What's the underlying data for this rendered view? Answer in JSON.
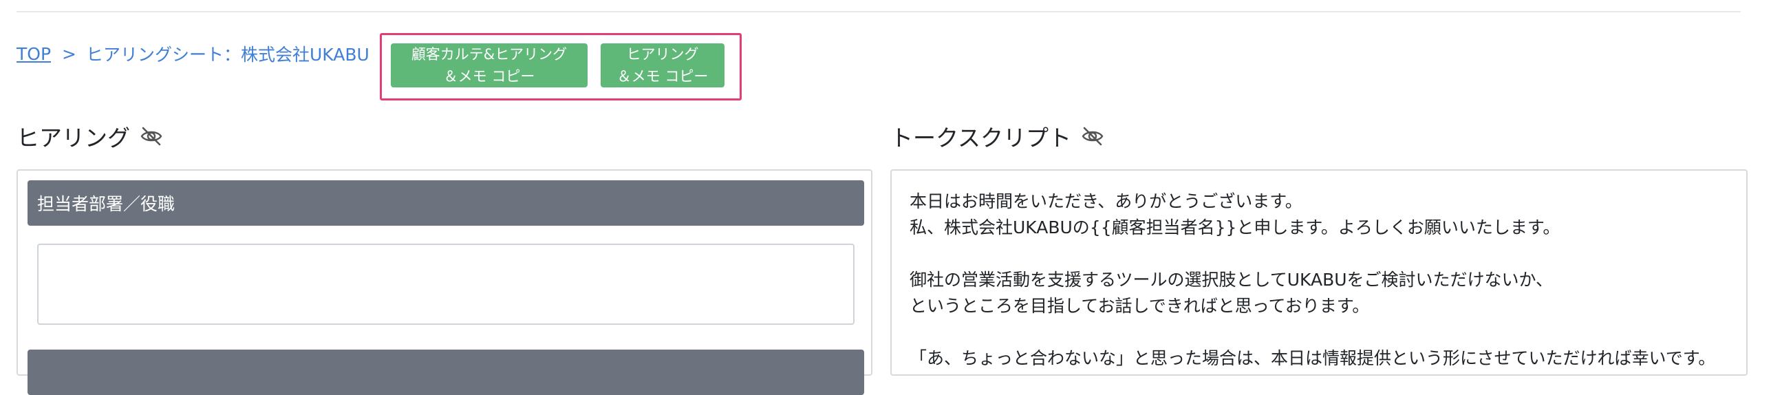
{
  "breadcrumb": {
    "top_link": "TOP",
    "separator": ">",
    "current": "ヒアリングシート：株式会社UKABU"
  },
  "copy_buttons": {
    "customer_karte_copy": "顧客カルテ&ヒアリング\n＆メモ コピー",
    "hearing_copy": "ヒアリング\n＆メモ コピー"
  },
  "hearing": {
    "title": "ヒアリング",
    "fields": [
      {
        "label": "担当者部署／役職",
        "value": ""
      },
      {
        "label": ""
      }
    ]
  },
  "talk_script": {
    "title": "トークスクリプト",
    "lines": [
      "本日はお時間をいただき、ありがとうございます。",
      "私、株式会社UKABUの{{顧客担当者名}}と申します。よろしくお願いいたします。",
      "",
      "御社の営業活動を支援するツールの選択肢としてUKABUをご検討いただけないか、",
      "というところを目指してお話しできればと思っております。",
      "",
      "「あ、ちょっと合わないな」と思った場合は、本日は情報提供という形にさせていただければ幸いです。"
    ]
  },
  "icons": {
    "visibility_toggle": "eye-slash-icon"
  },
  "colors": {
    "link": "#3f7fd6",
    "copy_button_bg": "#5fb878",
    "highlight_border": "#e33e73",
    "field_header_bg": "#6c737e"
  }
}
